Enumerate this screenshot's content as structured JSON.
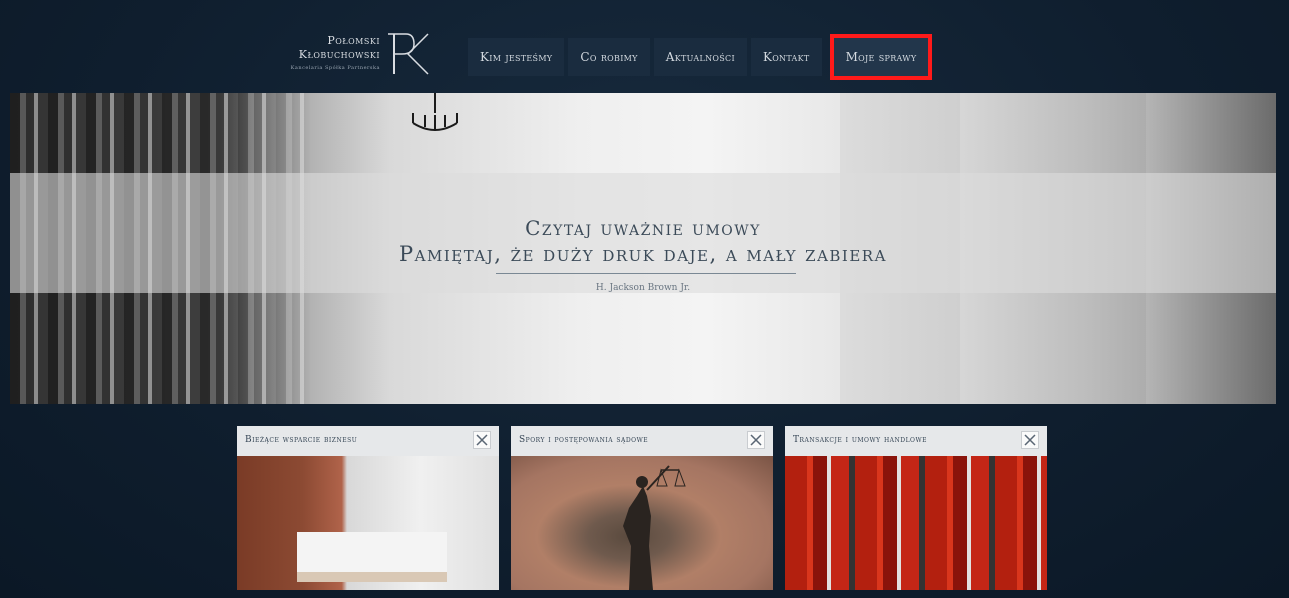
{
  "logo": {
    "line1": "Połomski",
    "line2": "Kłobuchowski",
    "line3": "Kancelaria Spółka Partnerska"
  },
  "nav": {
    "items": [
      {
        "label": "Kim jesteśmy"
      },
      {
        "label": "Co robimy"
      },
      {
        "label": "Aktualności"
      },
      {
        "label": "Kontakt"
      },
      {
        "label": "Moje sprawy"
      }
    ]
  },
  "hero": {
    "quote_line1": "Czytaj uważnie umowy",
    "quote_line2": "Pamiętaj, że duży druk daje, a mały zabiera",
    "author": "H. Jackson Brown Jr."
  },
  "cards": [
    {
      "title": "Bieżące wsparcie biznesu"
    },
    {
      "title": "Spory i postępowania sądowe"
    },
    {
      "title": "Transakcje i umowy handlowe"
    }
  ],
  "colors": {
    "background": "#0f1e2e",
    "nav_bg": "#1a2c3f",
    "highlight": "#ff1a1a"
  }
}
